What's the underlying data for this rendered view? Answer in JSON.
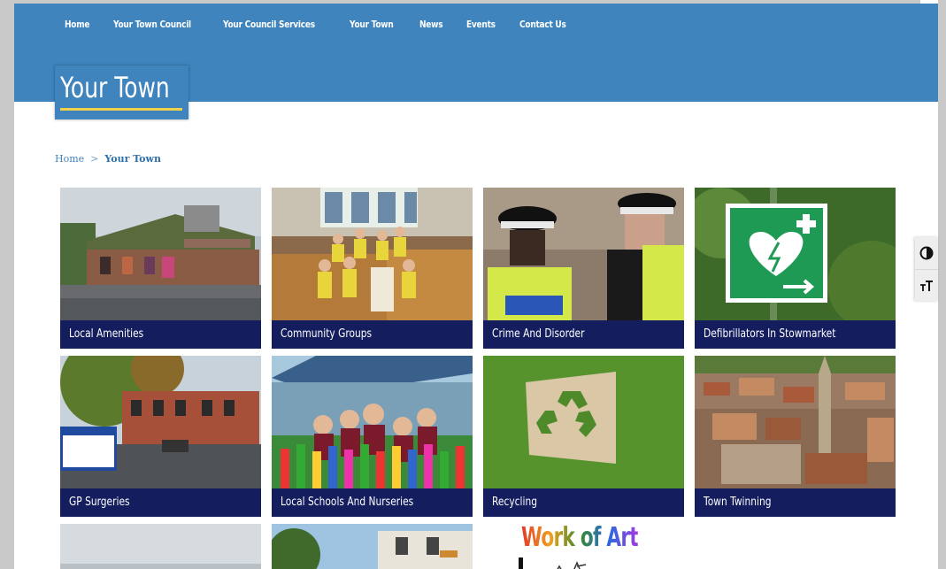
{
  "nav": {
    "items": [
      "Home",
      "Your Town Council",
      "Your Council Services",
      "Your Town",
      "News",
      "Events",
      "Contact Us"
    ]
  },
  "page_title": "Your Town",
  "breadcrumb": {
    "home": "Home",
    "separator": ">",
    "current": "Your Town"
  },
  "tiles": [
    {
      "label": "Local Amenities",
      "icon": "library-photo"
    },
    {
      "label": "Community Groups",
      "icon": "community-photo"
    },
    {
      "label": "Crime And Disorder",
      "icon": "police-photo"
    },
    {
      "label": "Defibrillators In Stowmarket",
      "icon": "defibrillator-photo"
    },
    {
      "label": "GP Surgeries",
      "icon": "gp-photo"
    },
    {
      "label": "Local Schools And Nurseries",
      "icon": "school-photo"
    },
    {
      "label": "Recycling",
      "icon": "recycling-photo"
    },
    {
      "label": "Town Twinning",
      "icon": "town-photo"
    }
  ],
  "partial_tiles": {
    "work_of_art": "Work of Art"
  },
  "accessibility": {
    "contrast": "contrast-icon",
    "text_size": "text-size-icon"
  },
  "colors": {
    "header": "#3f84bd",
    "tile_label": "#141d5e",
    "underline": "#f2d14a"
  }
}
